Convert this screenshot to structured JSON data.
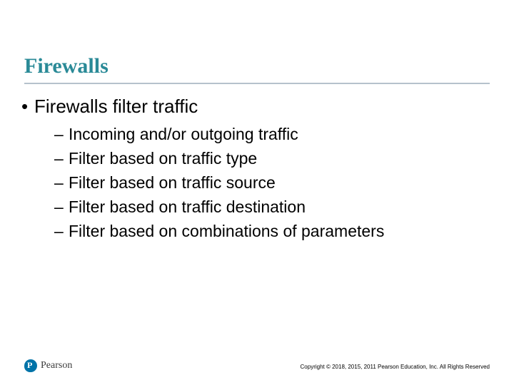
{
  "slide": {
    "title": "Firewalls",
    "bullet_l1": {
      "marker": "•",
      "text": "Firewalls filter traffic"
    },
    "bullets_l2": [
      {
        "marker": "–",
        "text": "Incoming and/or outgoing traffic"
      },
      {
        "marker": "–",
        "text": "Filter based on traffic type"
      },
      {
        "marker": "–",
        "text": "Filter based on traffic source"
      },
      {
        "marker": "–",
        "text": "Filter based on traffic destination"
      },
      {
        "marker": "–",
        "text": "Filter based on combinations of parameters"
      }
    ]
  },
  "footer": {
    "logo_text": "Pearson",
    "copyright": "Copyright © 2018, 2015, 2011 Pearson Education, Inc. All Rights Reserved"
  }
}
